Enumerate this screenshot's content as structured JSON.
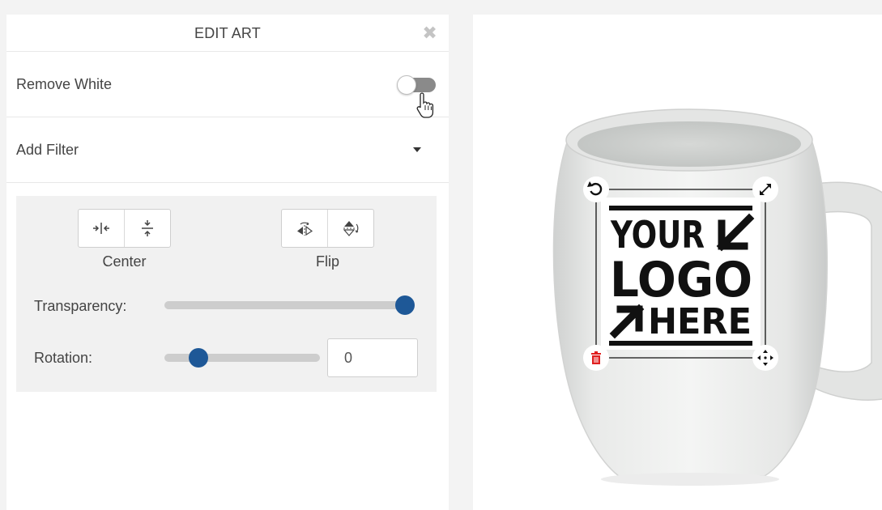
{
  "panel": {
    "title": "EDIT ART",
    "close_icon": "close-icon",
    "remove_white": {
      "label": "Remove White",
      "enabled": false
    },
    "add_filter": {
      "label": "Add Filter"
    },
    "center": {
      "label": "Center",
      "icons": [
        "center-horizontal-icon",
        "center-vertical-icon"
      ]
    },
    "flip": {
      "label": "Flip",
      "icons": [
        "flip-horizontal-icon",
        "flip-vertical-icon"
      ]
    },
    "transparency": {
      "label": "Transparency:",
      "value_fraction": 1.0
    },
    "rotation": {
      "label": "Rotation:",
      "value": "0",
      "slider_fraction": 0.18
    }
  },
  "preview": {
    "product": "mug",
    "logo_lines": [
      "YOUR",
      "LOGO",
      "HERE"
    ],
    "handles": [
      "rotate-icon",
      "resize-icon",
      "delete-icon",
      "move-icon"
    ],
    "colors": {
      "accent": "#1e5897",
      "delete": "#e02020",
      "logo": "#111111"
    }
  }
}
